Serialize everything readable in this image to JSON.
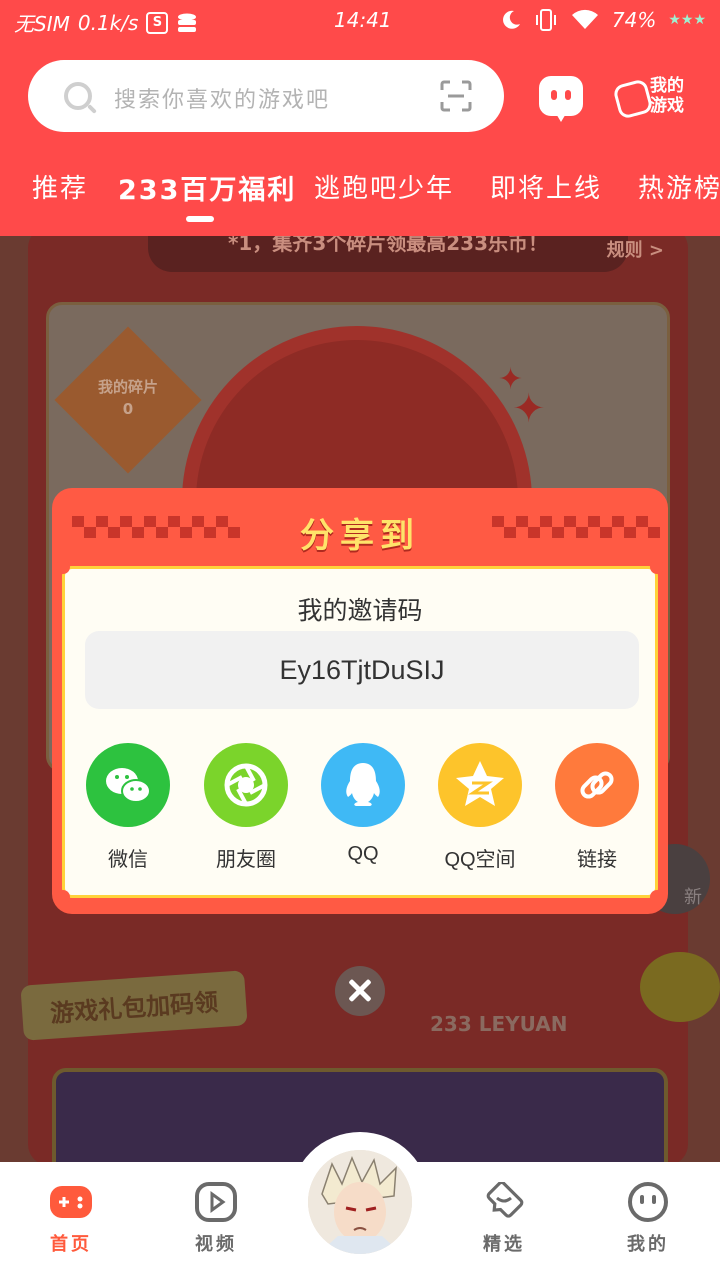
{
  "status_bar": {
    "carrier": "无SIM",
    "speed": "0.1k/s",
    "time": "14:41",
    "battery": "74%",
    "icons": [
      "s-badge-icon",
      "database-icon",
      "moon-icon",
      "vibrate-icon",
      "wifi-icon",
      "stars-icon"
    ]
  },
  "search": {
    "placeholder": "搜索你喜欢的游戏吧",
    "scan_icon": "scan-icon"
  },
  "header_actions": {
    "chat_icon": "chat-bubble-icon",
    "my_games_label": "我的游戏"
  },
  "tabs": [
    {
      "label": "推荐",
      "active": false
    },
    {
      "label": "233百万福利",
      "active": true
    },
    {
      "label": "逃跑吧少年",
      "active": false
    },
    {
      "label": "即将上线",
      "active": false
    },
    {
      "label": "热游榜",
      "active": false
    }
  ],
  "background": {
    "banner_text": "*1，集齐3个碎片领最高233乐币！",
    "rule_link": "规则 >",
    "fragment_label": "我的碎片",
    "fragment_count": "0",
    "gift_label": "游戏礼包加码领",
    "leyuan_text": "233 LEYUAN",
    "refresh_label": "新"
  },
  "dialog": {
    "title": "分享到",
    "invite_label": "我的邀请码",
    "invite_code": "Ey16TjtDuSIJ",
    "share_options": [
      {
        "label": "微信",
        "icon": "wechat-icon",
        "color": "#2dc23f"
      },
      {
        "label": "朋友圈",
        "icon": "moments-icon",
        "color": "#7bd42b"
      },
      {
        "label": "QQ",
        "icon": "qq-icon",
        "color": "#3fb9f5"
      },
      {
        "label": "QQ空间",
        "icon": "qzone-icon",
        "color": "#fdc42b"
      },
      {
        "label": "链接",
        "icon": "link-icon",
        "color": "#ff7a3c"
      }
    ]
  },
  "bottom_nav": [
    {
      "label": "首页",
      "icon": "gamepad-icon",
      "active": true
    },
    {
      "label": "视频",
      "icon": "video-play-icon",
      "active": false
    },
    {
      "label": "精选",
      "icon": "heart-chat-icon",
      "active": false
    },
    {
      "label": "我的",
      "icon": "face-icon",
      "active": false
    }
  ],
  "colors": {
    "header": "#ff4a4a",
    "accent": "#ff5a3c",
    "dialog": "#ff5a44",
    "dialog_title": "#ffe36a"
  }
}
